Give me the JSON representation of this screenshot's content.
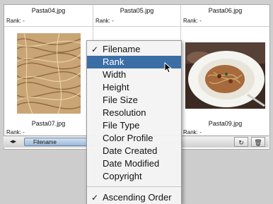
{
  "files": [
    {
      "name": "Pasta04.jpg",
      "rank_label": "Rank:",
      "rank": "-"
    },
    {
      "name": "Pasta05.jpg",
      "rank_label": "Rank:",
      "rank": "-"
    },
    {
      "name": "Pasta06.jpg",
      "rank_label": "Rank:",
      "rank": "-"
    },
    {
      "name": "Pasta07.jpg",
      "rank_label": "Rank:",
      "rank": "-"
    },
    {
      "name": "Pasta09.jpg",
      "rank_label": "Rank:",
      "rank": "-"
    }
  ],
  "toolbar": {
    "sort_label": "Filename",
    "nav_icon": "left-right-arrow-icon",
    "rotate_icon": "rotate-icon",
    "trash_icon": "trash-icon"
  },
  "menu": {
    "items": [
      {
        "label": "Filename",
        "checked": true
      },
      {
        "label": "Rank",
        "selected": true
      },
      {
        "label": "Width"
      },
      {
        "label": "Height"
      },
      {
        "label": "File Size"
      },
      {
        "label": "Resolution"
      },
      {
        "label": "File Type"
      },
      {
        "label": "Color Profile"
      },
      {
        "label": "Date Created"
      },
      {
        "label": "Date Modified"
      },
      {
        "label": "Copyright"
      }
    ],
    "order": {
      "label": "Ascending Order",
      "checked": true
    },
    "check_glyph": "✓",
    "highlight_color": "#3c6ea6"
  }
}
